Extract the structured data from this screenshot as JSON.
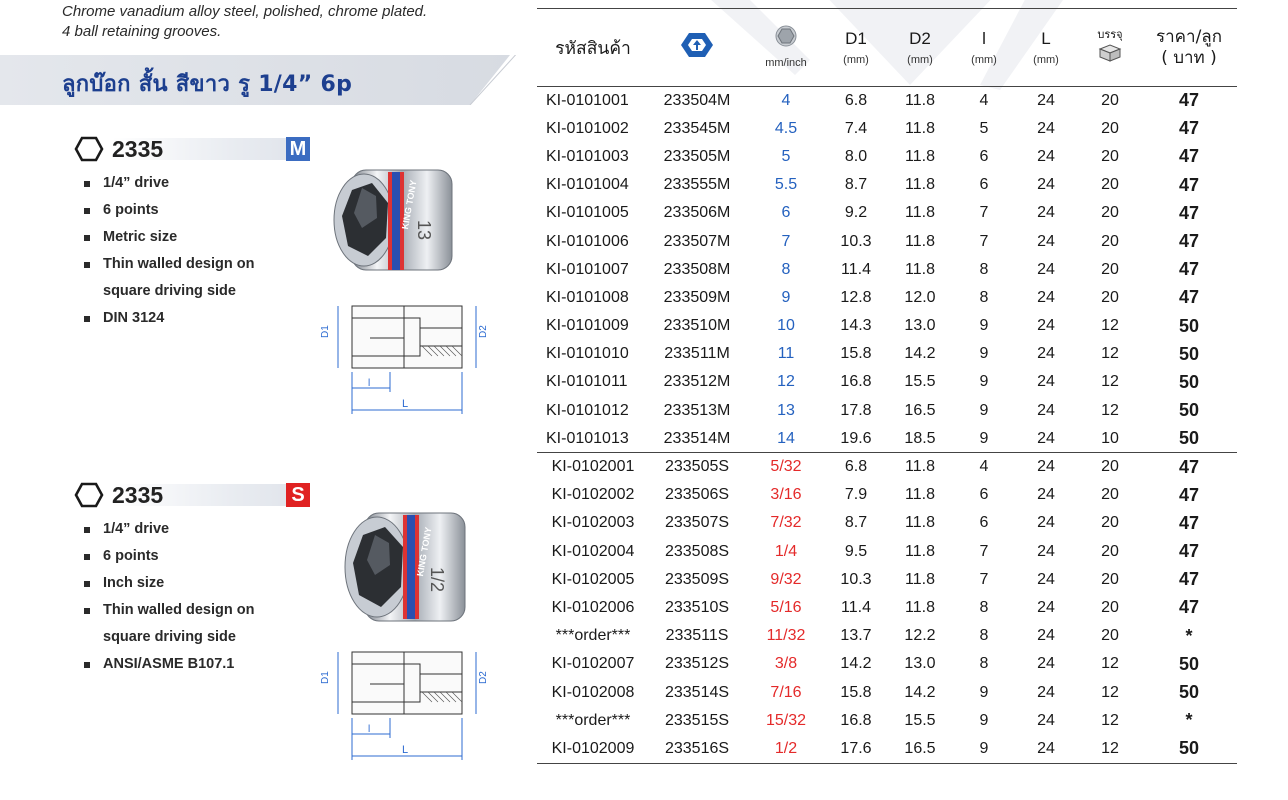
{
  "intro": {
    "line1": "Chrome vanadium alloy steel, polished, chrome plated.",
    "line2": "4 ball retaining grooves."
  },
  "section_title": "ลูกบ๊อก สั้น สีขาว รู 1/4” 6p",
  "products": [
    {
      "code": "2335",
      "badge": "M",
      "features": [
        "1/4” drive",
        "6 points",
        "Metric size",
        "Thin walled design on",
        "square driving side",
        "DIN 3124"
      ],
      "socket_marking": "13"
    },
    {
      "code": "2335",
      "badge": "S",
      "features": [
        "1/4” drive",
        "6 points",
        "Inch size",
        "Thin walled design on",
        "square driving side",
        "ANSI/ASME B107.1"
      ],
      "socket_marking": "1/2"
    }
  ],
  "drawing_labels": {
    "d1": "D1",
    "d2": "D2",
    "l_small": "l",
    "l_big": "L"
  },
  "brand_label": "KING TONY",
  "table": {
    "headers": {
      "code": "รหัสสินค้า",
      "size_unit": "mm/inch",
      "d1": "D1",
      "d1_unit": "(mm)",
      "d2": "D2",
      "d2_unit": "(mm)",
      "l_small": "l",
      "l_small_unit": "(mm)",
      "l_big": "L",
      "l_big_unit": "(mm)",
      "pack": "บรรจุ",
      "price_line1": "ราคา/ลูก",
      "price_line2": "( บาท )"
    },
    "colors": {
      "metric_size": "#2461bf",
      "inch_size": "#e42a2a",
      "brand_blue": "#1f5fb4"
    },
    "metric_rows": [
      [
        "KI-0101001",
        "233504M",
        "4",
        "6.8",
        "11.8",
        "4",
        "24",
        "20",
        "47"
      ],
      [
        "KI-0101002",
        "233545M",
        "4.5",
        "7.4",
        "11.8",
        "5",
        "24",
        "20",
        "47"
      ],
      [
        "KI-0101003",
        "233505M",
        "5",
        "8.0",
        "11.8",
        "6",
        "24",
        "20",
        "47"
      ],
      [
        "KI-0101004",
        "233555M",
        "5.5",
        "8.7",
        "11.8",
        "6",
        "24",
        "20",
        "47"
      ],
      [
        "KI-0101005",
        "233506M",
        "6",
        "9.2",
        "11.8",
        "7",
        "24",
        "20",
        "47"
      ],
      [
        "KI-0101006",
        "233507M",
        "7",
        "10.3",
        "11.8",
        "7",
        "24",
        "20",
        "47"
      ],
      [
        "KI-0101007",
        "233508M",
        "8",
        "11.4",
        "11.8",
        "8",
        "24",
        "20",
        "47"
      ],
      [
        "KI-0101008",
        "233509M",
        "9",
        "12.8",
        "12.0",
        "8",
        "24",
        "20",
        "47"
      ],
      [
        "KI-0101009",
        "233510M",
        "10",
        "14.3",
        "13.0",
        "9",
        "24",
        "12",
        "50"
      ],
      [
        "KI-0101010",
        "233511M",
        "11",
        "15.8",
        "14.2",
        "9",
        "24",
        "12",
        "50"
      ],
      [
        "KI-0101011",
        "233512M",
        "12",
        "16.8",
        "15.5",
        "9",
        "24",
        "12",
        "50"
      ],
      [
        "KI-0101012",
        "233513M",
        "13",
        "17.8",
        "16.5",
        "9",
        "24",
        "12",
        "50"
      ],
      [
        "KI-0101013",
        "233514M",
        "14",
        "19.6",
        "18.5",
        "9",
        "24",
        "10",
        "50"
      ]
    ],
    "inch_rows": [
      [
        "KI-0102001",
        "233505S",
        "5/32",
        "6.8",
        "11.8",
        "4",
        "24",
        "20",
        "47"
      ],
      [
        "KI-0102002",
        "233506S",
        "3/16",
        "7.9",
        "11.8",
        "6",
        "24",
        "20",
        "47"
      ],
      [
        "KI-0102003",
        "233507S",
        "7/32",
        "8.7",
        "11.8",
        "6",
        "24",
        "20",
        "47"
      ],
      [
        "KI-0102004",
        "233508S",
        "1/4",
        "9.5",
        "11.8",
        "7",
        "24",
        "20",
        "47"
      ],
      [
        "KI-0102005",
        "233509S",
        "9/32",
        "10.3",
        "11.8",
        "7",
        "24",
        "20",
        "47"
      ],
      [
        "KI-0102006",
        "233510S",
        "5/16",
        "11.4",
        "11.8",
        "8",
        "24",
        "20",
        "47"
      ],
      [
        "***order***",
        "233511S",
        "11/32",
        "13.7",
        "12.2",
        "8",
        "24",
        "20",
        "*"
      ],
      [
        "KI-0102007",
        "233512S",
        "3/8",
        "14.2",
        "13.0",
        "8",
        "24",
        "12",
        "50"
      ],
      [
        "KI-0102008",
        "233514S",
        "7/16",
        "15.8",
        "14.2",
        "9",
        "24",
        "12",
        "50"
      ],
      [
        "***order***",
        "233515S",
        "15/32",
        "16.8",
        "15.5",
        "9",
        "24",
        "12",
        "*"
      ],
      [
        "KI-0102009",
        "233516S",
        "1/2",
        "17.6",
        "16.5",
        "9",
        "24",
        "12",
        "50"
      ]
    ]
  }
}
